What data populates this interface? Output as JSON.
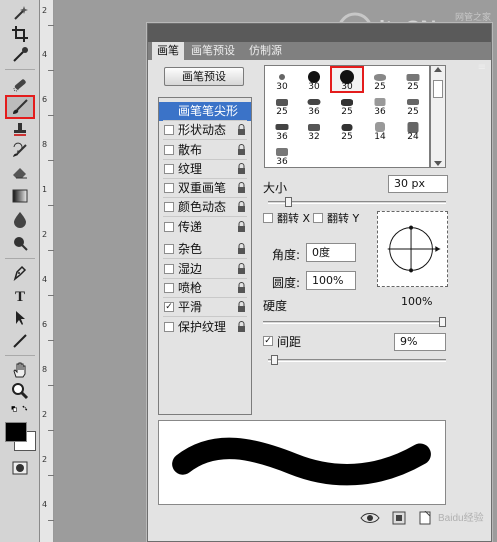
{
  "toolbar": {
    "tools": [
      "magic-wand-icon",
      "crop-icon",
      "eyedropper-icon",
      "spot-heal-icon",
      "brush-icon",
      "stamp-icon",
      "history-brush-icon",
      "eraser-icon",
      "gradient-icon",
      "blur-icon",
      "dodge-icon",
      "pen-icon",
      "type-icon",
      "path-select-icon",
      "line-icon",
      "hand-icon",
      "zoom-icon"
    ],
    "colors": {
      "foreground": "#000000",
      "background": "#ffffff",
      "highlight": "#e41c1c"
    }
  },
  "ruler": {
    "numbers": [
      "2",
      "4",
      "6",
      "8",
      "1",
      "2",
      "4",
      "6",
      "8",
      "2",
      "2",
      "4"
    ]
  },
  "panel": {
    "tabs": [
      "画笔",
      "画笔预设",
      "仿制源"
    ],
    "preset_button": "画笔预设",
    "options": [
      {
        "label": "画笔笔尖形状",
        "checkbox": false,
        "lock": false,
        "selected": true
      },
      {
        "label": "形状动态",
        "checkbox": false,
        "lock": true,
        "selected": false
      },
      {
        "label": "散布",
        "checkbox": false,
        "lock": true,
        "selected": false
      },
      {
        "label": "纹理",
        "checkbox": false,
        "lock": true,
        "selected": false
      },
      {
        "label": "双重画笔",
        "checkbox": false,
        "lock": true,
        "selected": false
      },
      {
        "label": "颜色动态",
        "checkbox": false,
        "lock": true,
        "selected": false
      },
      {
        "label": "传递",
        "checkbox": false,
        "lock": true,
        "selected": false
      },
      {
        "label": "杂色",
        "checkbox": false,
        "lock": true,
        "selected": false
      },
      {
        "label": "湿边",
        "checkbox": false,
        "lock": true,
        "selected": false
      },
      {
        "label": "喷枪",
        "checkbox": false,
        "lock": true,
        "selected": false
      },
      {
        "label": "平滑",
        "checkbox": true,
        "lock": true,
        "selected": false
      },
      {
        "label": "保护纹理",
        "checkbox": false,
        "lock": true,
        "selected": false
      }
    ],
    "brushes": [
      "30",
      "30",
      "30",
      "25",
      "25",
      "25",
      "36",
      "25",
      "36",
      "25",
      "36",
      "32",
      "25",
      "14",
      "24",
      "36"
    ],
    "selected_brush_index": 2,
    "size_label": "大小",
    "size_value": "30 px",
    "size_level": 0.1,
    "flip_x_label": "翻转 X",
    "flip_y_label": "翻转 Y",
    "angle_label": "角度:",
    "angle_value": "0度",
    "roundness_label": "圆度:",
    "roundness_value": "100%",
    "hardness_label": "硬度",
    "hardness_value": "100%",
    "hardness_level": 1.0,
    "spacing_label": "间距",
    "spacing_checked": true,
    "spacing_value": "9%",
    "spacing_level": 0.02
  },
  "watermark": {
    "text": "itsCN.com",
    "subtext": "网管之家"
  },
  "bottom_watermark": "Baidu经验"
}
